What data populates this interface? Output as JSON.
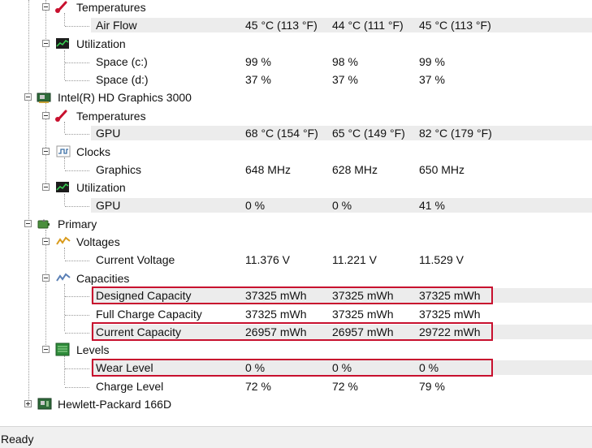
{
  "tree": {
    "hdd": {
      "temperatures": {
        "label": "Temperatures",
        "airflow": {
          "label": "Air Flow",
          "values": [
            "45 °C  (113 °F)",
            "44 °C  (111 °F)",
            "45 °C  (113 °F)"
          ]
        }
      },
      "utilization": {
        "label": "Utilization",
        "space_c": {
          "label": "Space (c:)",
          "values": [
            "99 %",
            "98 %",
            "99 %"
          ]
        },
        "space_d": {
          "label": "Space (d:)",
          "values": [
            "37 %",
            "37 %",
            "37 %"
          ]
        }
      }
    },
    "gpu": {
      "label": "Intel(R) HD Graphics 3000",
      "temperatures": {
        "label": "Temperatures",
        "gpu": {
          "label": "GPU",
          "values": [
            "68 °C  (154 °F)",
            "65 °C  (149 °F)",
            "82 °C  (179 °F)"
          ]
        }
      },
      "clocks": {
        "label": "Clocks",
        "graphics": {
          "label": "Graphics",
          "values": [
            "648 MHz",
            "628 MHz",
            "650 MHz"
          ]
        }
      },
      "utilization": {
        "label": "Utilization",
        "gpu": {
          "label": "GPU",
          "values": [
            "0 %",
            "0 %",
            "41 %"
          ]
        }
      }
    },
    "battery": {
      "label": "Primary",
      "voltages": {
        "label": "Voltages",
        "current": {
          "label": "Current Voltage",
          "values": [
            "11.376 V",
            "11.221 V",
            "11.529 V"
          ]
        }
      },
      "capacities": {
        "label": "Capacities",
        "designed": {
          "label": "Designed Capacity",
          "values": [
            "37325 mWh",
            "37325 mWh",
            "37325 mWh"
          ]
        },
        "full_charge": {
          "label": "Full Charge Capacity",
          "values": [
            "37325 mWh",
            "37325 mWh",
            "37325 mWh"
          ]
        },
        "current": {
          "label": "Current Capacity",
          "values": [
            "26957 mWh",
            "26957 mWh",
            "29722 mWh"
          ]
        }
      },
      "levels": {
        "label": "Levels",
        "wear": {
          "label": "Wear Level",
          "values": [
            "0 %",
            "0 %",
            "0 %"
          ]
        },
        "charge": {
          "label": "Charge Level",
          "values": [
            "72 %",
            "72 %",
            "79 %"
          ]
        }
      }
    },
    "motherboard": {
      "label": "Hewlett-Packard 166D"
    }
  },
  "status": {
    "text": "Ready"
  },
  "colors": {
    "highlight": "#c8102e",
    "stripe": "#ececec",
    "temp_icon": "#c8102e",
    "green_icon": "#2e8b3a"
  },
  "icons": {
    "temperatures": "thermometer-icon",
    "utilization": "utilization-graph-icon",
    "gpu": "graphics-card-icon",
    "clocks": "clock-wave-icon",
    "battery": "battery-icon",
    "voltages": "voltage-icon",
    "capacities": "capacity-icon",
    "levels": "levels-icon",
    "motherboard": "motherboard-icon"
  }
}
